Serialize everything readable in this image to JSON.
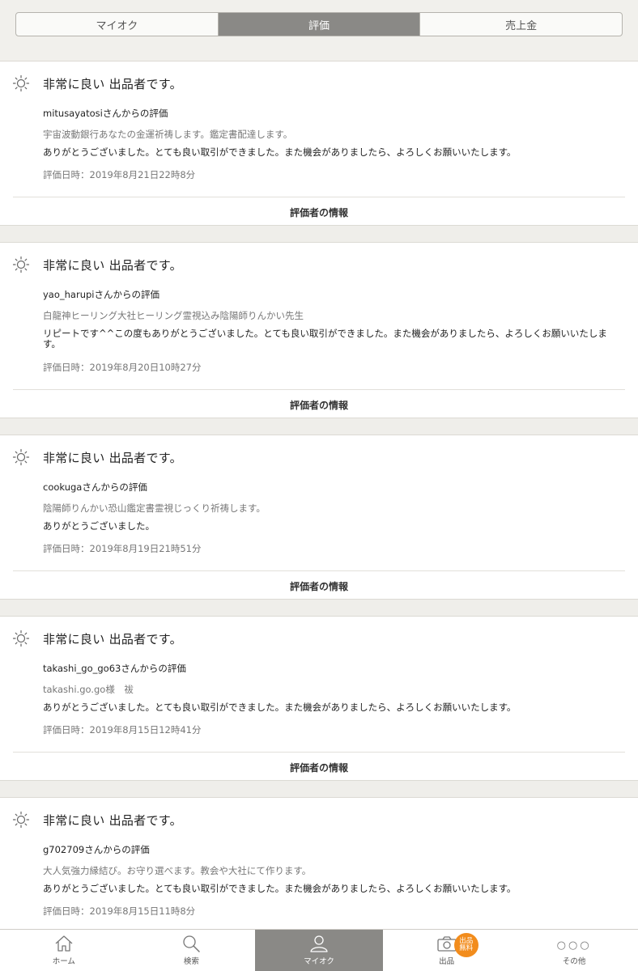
{
  "segments": [
    {
      "label": "マイオク",
      "active": false
    },
    {
      "label": "評価",
      "active": true
    },
    {
      "label": "売上金",
      "active": false
    }
  ],
  "reviews": [
    {
      "rating": "非常に良い 出品者です。",
      "from": "mitusayatosiさんからの評価",
      "item": "宇宙波動銀行あなたの金運祈祷します。鑑定書配達します。",
      "comment": "ありがとうございました。とても良い取引ができました。また機会がありましたら、よろしくお願いいたします。",
      "date": "評価日時：2019年8月21日22時8分",
      "info_label": "評価者の情報"
    },
    {
      "rating": "非常に良い 出品者です。",
      "from": "yao_harupiさんからの評価",
      "item": "白龍神ヒーリング大社ヒーリング霊視込み陰陽師りんかい先生",
      "comment": "リピートです^^この度もありがとうございました。とても良い取引ができました。また機会がありましたら、よろしくお願いいたします。",
      "date": "評価日時：2019年8月20日10時27分",
      "info_label": "評価者の情報"
    },
    {
      "rating": "非常に良い 出品者です。",
      "from": "cookugaさんからの評価",
      "item": "陰陽師りんかい恐山鑑定書霊視じっくり祈祷します。",
      "comment": "ありがとうございました。",
      "date": "評価日時：2019年8月19日21時51分",
      "info_label": "評価者の情報"
    },
    {
      "rating": "非常に良い 出品者です。",
      "from": "takashi_go_go63さんからの評価",
      "item": "takashi.go.go様　祓",
      "comment": "ありがとうございました。とても良い取引ができました。また機会がありましたら、よろしくお願いいたします。",
      "date": "評価日時：2019年8月15日12時41分",
      "info_label": "評価者の情報"
    },
    {
      "rating": "非常に良い 出品者です。",
      "from": "g702709さんからの評価",
      "item": "大人気強力縁結び。お守り選べます。教会や大社にて作ります。",
      "comment": "ありがとうございました。とても良い取引ができました。また機会がありましたら、よろしくお願いいたします。",
      "date": "評価日時：2019年8月15日11時8分",
      "info_label": ""
    }
  ],
  "tabbar": {
    "home": "ホーム",
    "search": "検索",
    "myauction": "マイオク",
    "sell": "出品",
    "sell_badge_line1": "出品",
    "sell_badge_line2": "無料",
    "other": "その他",
    "other_dots": "○○○",
    "active": "myauction",
    "badge_color": "#f28c1c"
  },
  "icons": {
    "rating": "sun-smile-icon",
    "home": "home-icon",
    "search": "search-icon",
    "myauction": "person-icon",
    "sell": "camera-icon"
  },
  "colors": {
    "active_tab_bg": "#8a8986",
    "page_bg": "#efeeea"
  }
}
